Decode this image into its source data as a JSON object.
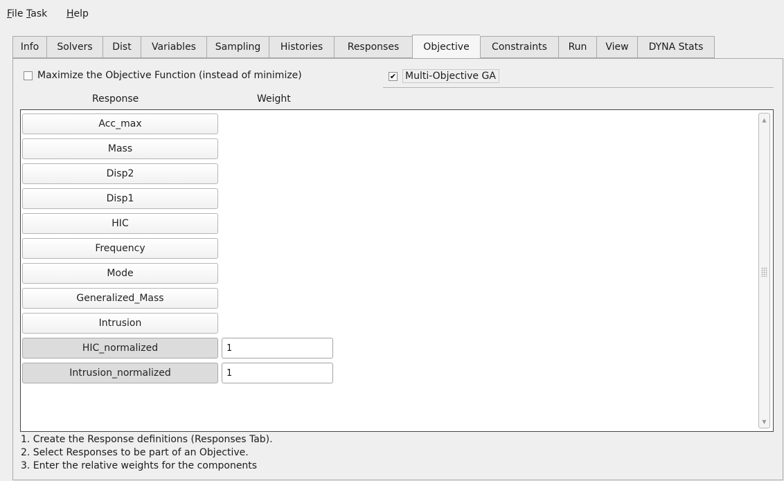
{
  "menubar": {
    "items": [
      {
        "mnemonic": "F",
        "rest": "ile"
      },
      {
        "mnemonic": "T",
        "rest": "ask"
      },
      {
        "mnemonic": "H",
        "rest": "elp"
      }
    ]
  },
  "tabs": [
    {
      "label": "Info"
    },
    {
      "label": "Solvers"
    },
    {
      "label": "Dist"
    },
    {
      "label": "Variables"
    },
    {
      "label": "Sampling"
    },
    {
      "label": "Histories"
    },
    {
      "label": "Responses"
    },
    {
      "label": "Objective",
      "active": true
    },
    {
      "label": "Constraints"
    },
    {
      "label": "Run"
    },
    {
      "label": "View"
    },
    {
      "label": "DYNA Stats"
    }
  ],
  "options": {
    "maximize": {
      "label": "Maximize the Objective Function (instead of minimize)",
      "checked": false
    },
    "multi_objective": {
      "label": "Multi-Objective GA",
      "checked": true
    }
  },
  "columns": {
    "response": "Response",
    "weight": "Weight"
  },
  "responses": [
    {
      "name": "Acc_max",
      "selected": false,
      "weight": null
    },
    {
      "name": "Mass",
      "selected": false,
      "weight": null
    },
    {
      "name": "Disp2",
      "selected": false,
      "weight": null
    },
    {
      "name": "Disp1",
      "selected": false,
      "weight": null
    },
    {
      "name": "HIC",
      "selected": false,
      "weight": null
    },
    {
      "name": "Frequency",
      "selected": false,
      "weight": null
    },
    {
      "name": "Mode",
      "selected": false,
      "weight": null
    },
    {
      "name": "Generalized_Mass",
      "selected": false,
      "weight": null
    },
    {
      "name": "Intrusion",
      "selected": false,
      "weight": null
    },
    {
      "name": "HIC_normalized",
      "selected": true,
      "weight": "1"
    },
    {
      "name": "Intrusion_normalized",
      "selected": true,
      "weight": "1"
    }
  ],
  "instructions": [
    "1. Create the Response definitions (Responses Tab).",
    "2. Select Responses to be part of an Objective.",
    "3. Enter the relative weights for the components"
  ],
  "icons": {
    "check": "checkmark-icon",
    "scroll_up": "scroll-up-icon",
    "scroll_down": "scroll-down-icon"
  }
}
